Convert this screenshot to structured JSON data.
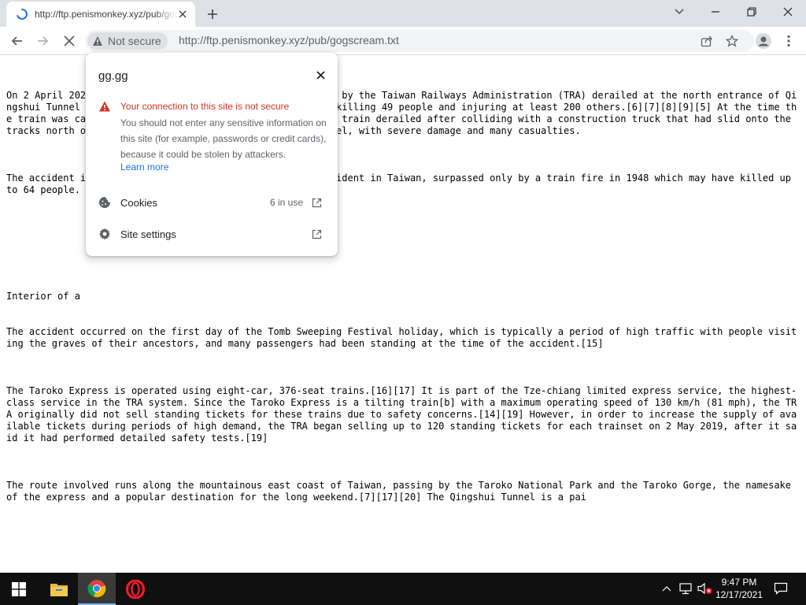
{
  "browser": {
    "tab": {
      "title": "http://ftp.penismonkey.xyz/pub/gogscream.txt",
      "close_icon": "close-icon",
      "loading_icon": "spinner-icon"
    },
    "new_tab_icon": "plus-icon",
    "window_controls": [
      "chevron-down-icon",
      "minimize-icon",
      "restore-icon",
      "close-icon"
    ],
    "toolbar": {
      "back_icon": "arrow-left-icon",
      "forward_icon": "arrow-right-icon",
      "stop_icon": "close-icon",
      "security_chip": "Not secure",
      "url": "http://ftp.penismonkey.xyz/pub/gogscream.txt",
      "share_icon": "share-icon",
      "bookmark_icon": "star-icon",
      "profile_icon": "profile-icon",
      "menu_icon": "kebab-menu-icon"
    }
  },
  "site_info": {
    "host": "gg.gg",
    "warning_title": "Your connection to this site is not secure",
    "warning_body": "You should not enter any sensitive information on this site (for example, passwords or credit cards), because it could be stolen by attackers.",
    "learn_more": "Learn more",
    "cookies_label": "Cookies",
    "cookies_value": "6 in use",
    "site_settings_label": "Site settings",
    "warning_color": "#d93025",
    "link_color": "#1a73e8"
  },
  "page": {
    "paragraphs": [
      "On 2 April 2021, a Taroko Express passenger train operated by the Taiwan Railways Administration (TRA) derailed at the north entrance of Qingshui Tunnel in Xiulin Township, Hualien County, Taiwan, killing 49 people and injuring at least 200 others.[6][7][8][9][5] At the time the train was carrying 494 passengers.[3] The eight-carriage train derailed after colliding with a construction truck that had slid onto the tracks north of Hualien City, and came to rest in the tunnel, with severe damage and many casualties.",
      "The accident is the deadliest since the deadliest rail accident in Taiwan, surpassed only by a train fire in 1948 which may have killed up to 64 people.",
      "Interior of a",
      "The accident occurred on the first day of the Tomb Sweeping Festival holiday, which is typically a period of high traffic with people visiting the graves of their ancestors, and many passengers had been standing at the time of the accident.[15]",
      "The Taroko Express is operated using eight-car, 376-seat trains.[16][17] It is part of the Tze-chiang limited express service, the highest-class service in the TRA system. Since the Taroko Express is a tilting train[b] with a maximum operating speed of 130 km/h (81 mph), the TRA originally did not sell standing tickets for these trains due to safety concerns.[14][19] However, in order to increase the supply of available tickets during periods of high demand, the TRA began selling up to 120 standing tickets for each trainset on 2 May 2019, after it said it had performed detailed safety tests.[19]",
      "The route involved runs along the mountainous east coast of Taiwan, passing by the Taroko National Park and the Taroko Gorge, the namesake of the express and a popular destination for the long weekend.[7][17][20] The Qingshui Tunnel is a pai"
    ]
  },
  "taskbar": {
    "start_icon": "windows-start-icon",
    "apps": [
      "file-explorer-icon",
      "chrome-icon",
      "opera-icon"
    ],
    "tray_icons": [
      "chevron-up-icon",
      "network-icon",
      "volume-muted-icon"
    ],
    "time": "9:47 PM",
    "date": "12/17/2021",
    "notification_icon": "notification-icon"
  }
}
